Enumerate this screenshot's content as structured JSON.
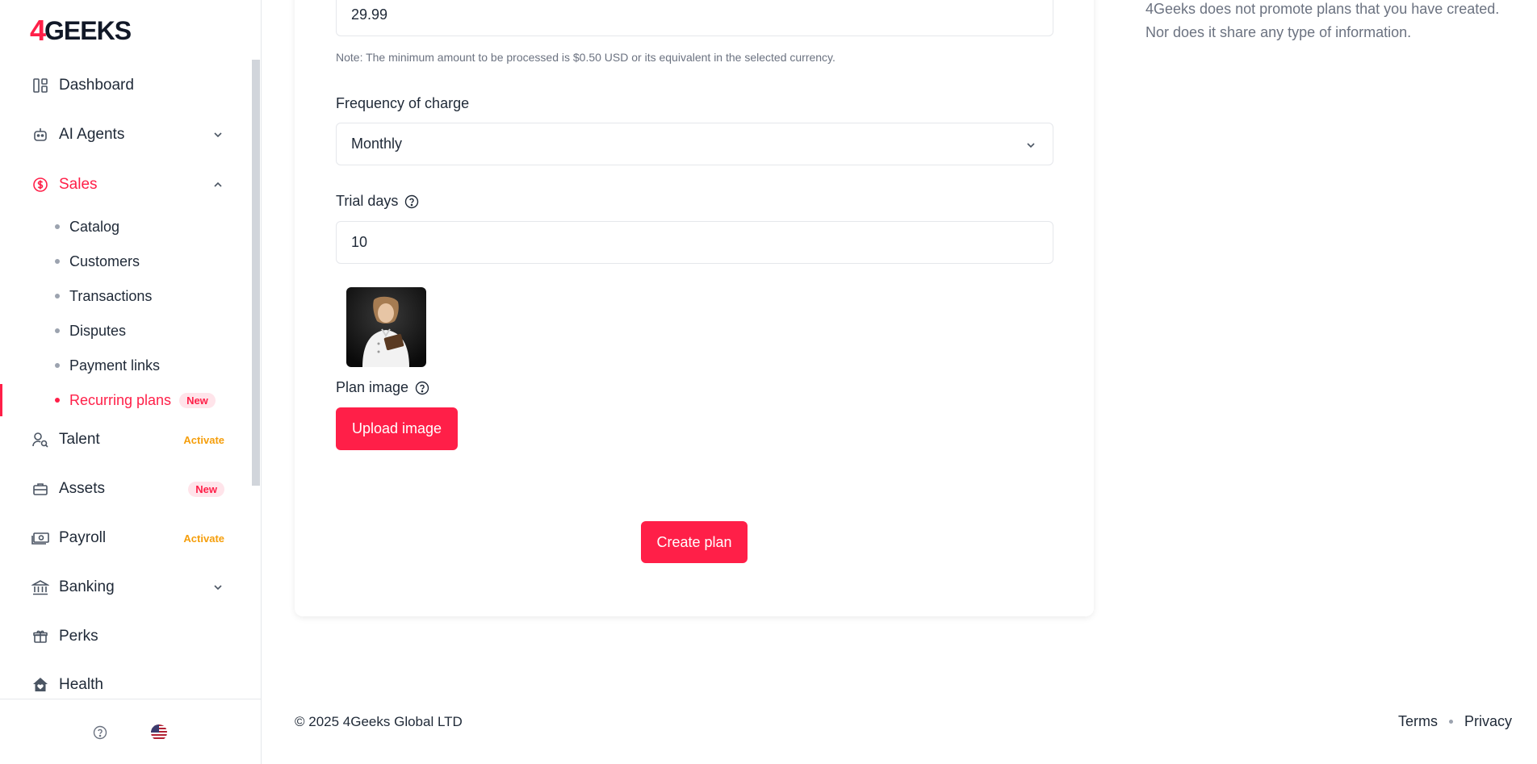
{
  "brand": {
    "logo_mark": "4",
    "logo_text": "GEEKS"
  },
  "sidebar": {
    "items": [
      {
        "label": "Dashboard",
        "icon": "dashboard-icon"
      },
      {
        "label": "AI Agents",
        "icon": "robot-icon"
      },
      {
        "label": "Sales",
        "icon": "dollar-circle-icon"
      },
      {
        "label": "Talent",
        "icon": "user-search-icon",
        "badge": "Activate"
      },
      {
        "label": "Assets",
        "icon": "briefcase-icon",
        "badge": "New"
      },
      {
        "label": "Payroll",
        "icon": "cash-icon",
        "badge": "Activate"
      },
      {
        "label": "Banking",
        "icon": "bank-icon"
      },
      {
        "label": "Perks",
        "icon": "gift-icon"
      },
      {
        "label": "Health",
        "icon": "house-heart-icon"
      }
    ],
    "sales_sub": [
      {
        "label": "Catalog"
      },
      {
        "label": "Customers"
      },
      {
        "label": "Transactions"
      },
      {
        "label": "Disputes"
      },
      {
        "label": "Payment links"
      },
      {
        "label": "Recurring plans",
        "badge": "New"
      }
    ],
    "accent_color": "#ff1f48"
  },
  "form": {
    "price_value": "29.99",
    "price_note": "Note: The minimum amount to be processed is $0.50 USD or its equivalent in the selected currency.",
    "frequency_label": "Frequency of charge",
    "frequency_value": "Monthly",
    "trial_label": "Trial days",
    "trial_value": "10",
    "plan_image_label": "Plan image",
    "upload_button": "Upload image",
    "create_button": "Create plan"
  },
  "side_note": "4Geeks does not promote plans that you have created. Nor does it share any type of information.",
  "footer": {
    "copyright": "© 2025 4Geeks Global LTD",
    "terms": "Terms",
    "privacy": "Privacy"
  }
}
